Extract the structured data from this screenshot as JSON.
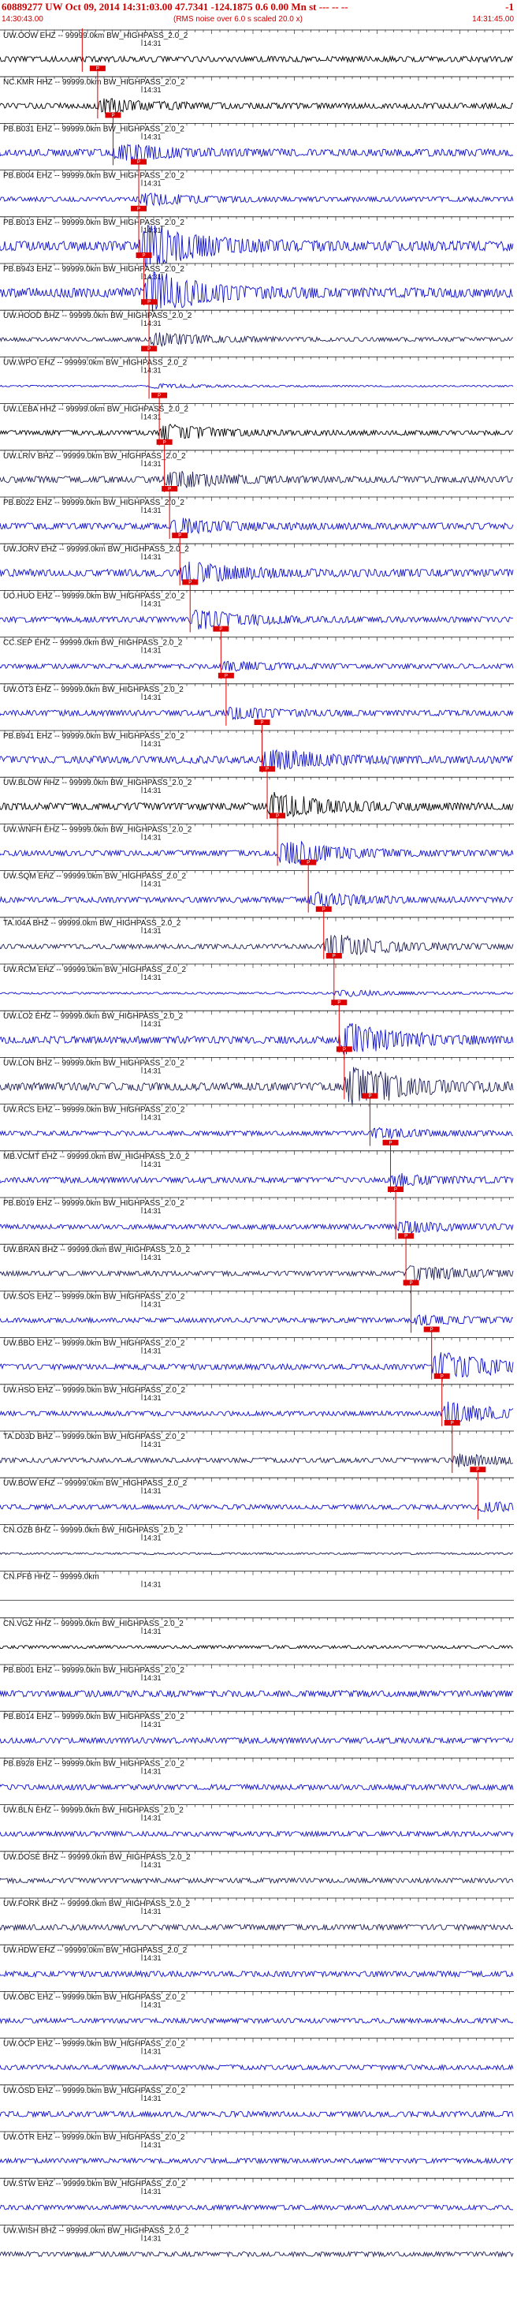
{
  "header": {
    "title": "60889277 UW Oct 09, 2014 14:31:03.00   47.7341 -124.1875  0.6 0.00 Mn st --- -- --",
    "right": "-1",
    "start_time": "14:30:43.00",
    "note": "(RMS noise over 6.0 s scaled 20.0 x)",
    "end_time": "14:31:45.00"
  },
  "colors": {
    "trace_blue": "#1010d0",
    "trace_black": "#000000",
    "trace_navy": "#20205a",
    "pick": "#dd0000",
    "axis": "#111111"
  },
  "chart_data": {
    "type": "line",
    "title": "60889277 UW Oct 09, 2014 14:31:03.00 47.7341 -124.1875 0.6 0.00 Mn",
    "x_range": [
      "14:30:43.00",
      "14:31:45.00"
    ],
    "time_marker": "14:31",
    "pick_label": "P",
    "traces": [
      {
        "label": "UW.OOW EHZ -- 99999.0km BW_HIGHPASS_2.0_2",
        "pick_t": 0.16,
        "amp": 0.35,
        "event": 0.0,
        "color": "black"
      },
      {
        "label": "NC.KMR HHZ -- 99999.0km BW_HIGHPASS_2.0_2",
        "pick_t": 0.19,
        "amp": 0.35,
        "event": 0.6,
        "color": "black"
      },
      {
        "label": "PB.B031 EHZ -- 99999.0km BW_HIGHPASS_2.0_2",
        "pick_t": 0.22,
        "amp": 0.45,
        "event": 0.7,
        "color": "blue"
      },
      {
        "label": "PB.B004 EHZ -- 99999.0km BW_HIGHPASS_2.0_2",
        "pick_t": 0.27,
        "amp": 0.3,
        "event": 0.5,
        "color": "blue"
      },
      {
        "label": "PB.B013 EHZ -- 99999.0km BW_HIGHPASS_2.0_2",
        "pick_t": 0.27,
        "amp": 0.6,
        "event": 2.2,
        "color": "blue"
      },
      {
        "label": "PB.B943 EHZ -- 99999.0km BW_HIGHPASS_2.0_2",
        "pick_t": 0.28,
        "amp": 0.6,
        "event": 2.0,
        "color": "blue"
      },
      {
        "label": "UW.HOOD BHZ -- 99999.0km BW_HIGHPASS_2.0_2",
        "pick_t": 0.29,
        "amp": 0.25,
        "event": 0.6,
        "color": "navy"
      },
      {
        "label": "UW.WPO EHZ -- 99999.0km BW_HIGHPASS_2.0_2",
        "pick_t": 0.29,
        "amp": 0.1,
        "event": 0.2,
        "color": "blue"
      },
      {
        "label": "UW.LEBA HHZ -- 99999.0km BW_HIGHPASS_2.0_2",
        "pick_t": 0.31,
        "amp": 0.3,
        "event": 0.8,
        "color": "black"
      },
      {
        "label": "UW.LRIV BHZ -- 99999.0km BW_HIGHPASS_2.0_2",
        "pick_t": 0.32,
        "amp": 0.4,
        "event": 0.8,
        "color": "navy"
      },
      {
        "label": "PB.B022 EHZ -- 99999.0km BW_HIGHPASS_2.0_2",
        "pick_t": 0.33,
        "amp": 0.4,
        "event": 0.6,
        "color": "blue"
      },
      {
        "label": "UW.JORV EHZ -- 99999.0km BW_HIGHPASS_2.0_2",
        "pick_t": 0.35,
        "amp": 0.45,
        "event": 1.0,
        "color": "blue"
      },
      {
        "label": "UO.HUO EHZ -- 99999.0km BW_HIGHPASS_2.0_2",
        "pick_t": 0.37,
        "amp": 0.35,
        "event": 0.9,
        "color": "blue"
      },
      {
        "label": "CC.SEP EHZ -- 99999.0km BW_HIGHPASS_2.0_2",
        "pick_t": 0.43,
        "amp": 0.3,
        "event": 0.4,
        "color": "blue"
      },
      {
        "label": "UW.OT3 EHZ -- 99999.0km BW_HIGHPASS_2.0_2",
        "pick_t": 0.44,
        "amp": 0.35,
        "event": 0.5,
        "color": "blue"
      },
      {
        "label": "PB.B941 EHZ -- 99999.0km BW_HIGHPASS_2.0_2",
        "pick_t": 0.51,
        "amp": 0.45,
        "event": 1.0,
        "color": "blue"
      },
      {
        "label": "UW.BLOW HHZ -- 99999.0km BW_HIGHPASS_2.0_2",
        "pick_t": 0.52,
        "amp": 0.45,
        "event": 1.2,
        "color": "black"
      },
      {
        "label": "UW.WNFH EHZ -- 99999.0km BW_HIGHPASS_2.0_2",
        "pick_t": 0.54,
        "amp": 0.35,
        "event": 1.3,
        "color": "blue"
      },
      {
        "label": "UW.SQM EHZ -- 99999.0km BW_HIGHPASS_2.0_2",
        "pick_t": 0.6,
        "amp": 0.35,
        "event": 0.6,
        "color": "blue"
      },
      {
        "label": "TA.I04A BHZ -- 99999.0km BW_HIGHPASS_2.0_2",
        "pick_t": 0.63,
        "amp": 0.3,
        "event": 1.2,
        "color": "navy"
      },
      {
        "label": "UW.RCM EHZ -- 99999.0km BW_HIGHPASS_2.0_2",
        "pick_t": 0.65,
        "amp": 0.12,
        "event": 0.3,
        "color": "blue"
      },
      {
        "label": "UW.LO2 EHZ -- 99999.0km BW_HIGHPASS_2.0_2",
        "pick_t": 0.66,
        "amp": 0.45,
        "event": 1.6,
        "color": "blue"
      },
      {
        "label": "UW.LON BHZ -- 99999.0km BW_HIGHPASS_2.0_2",
        "pick_t": 0.67,
        "amp": 0.5,
        "event": 2.0,
        "color": "navy"
      },
      {
        "label": "UW.RCS EHZ -- 99999.0km BW_HIGHPASS_2.0_2",
        "pick_t": 0.72,
        "amp": 0.3,
        "event": 0.4,
        "color": "blue"
      },
      {
        "label": "MB.VCMT EHZ -- 99999.0km BW_HIGHPASS_2.0_2",
        "pick_t": 0.76,
        "amp": 0.35,
        "event": 0.5,
        "color": "blue"
      },
      {
        "label": "PB.B019 EHZ -- 99999.0km BW_HIGHPASS_2.0_2",
        "pick_t": 0.77,
        "amp": 0.3,
        "event": 0.5,
        "color": "blue"
      },
      {
        "label": "UW.BRAN BHZ -- 99999.0km BW_HIGHPASS_2.0_2",
        "pick_t": 0.79,
        "amp": 0.3,
        "event": 0.7,
        "color": "navy"
      },
      {
        "label": "UW.SOS EHZ -- 99999.0km BW_HIGHPASS_2.0_2",
        "pick_t": 0.8,
        "amp": 0.3,
        "event": 0.4,
        "color": "blue"
      },
      {
        "label": "UW.BBO EHZ -- 99999.0km BW_HIGHPASS_2.0_2",
        "pick_t": 0.84,
        "amp": 0.35,
        "event": 1.5,
        "color": "blue"
      },
      {
        "label": "UW.HSO EHZ -- 99999.0km BW_HIGHPASS_2.0_2",
        "pick_t": 0.86,
        "amp": 0.3,
        "event": 1.0,
        "color": "blue"
      },
      {
        "label": "TA.D03D BHZ -- 99999.0km BW_HIGHPASS_2.0_2",
        "pick_t": 0.88,
        "amp": 0.3,
        "event": 0.5,
        "color": "navy"
      },
      {
        "label": "UW.BOW EHZ -- 99999.0km BW_HIGHPASS_2.0_2",
        "pick_t": 0.93,
        "amp": 0.3,
        "event": 0.4,
        "color": "blue"
      },
      {
        "label": "CN.OZB BHZ -- 99999.0km BW_HIGHPASS_2.0_2",
        "pick_t": null,
        "amp": 0.12,
        "event": 0.0,
        "color": "navy"
      },
      {
        "label": "CN.PFB HHZ -- 99999.0km",
        "pick_t": null,
        "amp": 0.0,
        "event": 0.0,
        "color": "black"
      },
      {
        "label": "CN.VGZ HHZ -- 99999.0km BW_HIGHPASS_2.0_2",
        "pick_t": null,
        "amp": 0.2,
        "event": 0.0,
        "color": "black"
      },
      {
        "label": "PB.B001 EHZ -- 99999.0km BW_HIGHPASS_2.0_2",
        "pick_t": null,
        "amp": 0.4,
        "event": 0.0,
        "color": "blue"
      },
      {
        "label": "PB.B014 EHZ -- 99999.0km BW_HIGHPASS_2.0_2",
        "pick_t": null,
        "amp": 0.35,
        "event": 0.0,
        "color": "blue"
      },
      {
        "label": "PB.B928 EHZ -- 99999.0km BW_HIGHPASS_2.0_2",
        "pick_t": null,
        "amp": 0.35,
        "event": 0.0,
        "color": "blue"
      },
      {
        "label": "UW.BLN EHZ -- 99999.0km BW_HIGHPASS_2.0_2",
        "pick_t": null,
        "amp": 0.3,
        "event": 0.0,
        "color": "blue"
      },
      {
        "label": "UW.DOSE BHZ -- 99999.0km BW_HIGHPASS_2.0_2",
        "pick_t": null,
        "amp": 0.3,
        "event": 0.0,
        "color": "navy"
      },
      {
        "label": "UW.FORK BHZ -- 99999.0km BW_HIGHPASS_2.0_2",
        "pick_t": null,
        "amp": 0.35,
        "event": 0.0,
        "color": "navy"
      },
      {
        "label": "UW.HDW EHZ -- 99999.0km BW_HIGHPASS_2.0_2",
        "pick_t": null,
        "amp": 0.35,
        "event": 0.0,
        "color": "blue"
      },
      {
        "label": "UW.OBC EHZ -- 99999.0km BW_HIGHPASS_2.0_2",
        "pick_t": null,
        "amp": 0.3,
        "event": 0.0,
        "color": "blue"
      },
      {
        "label": "UW.OCP EHZ -- 99999.0km BW_HIGHPASS_2.0_2",
        "pick_t": null,
        "amp": 0.3,
        "event": 0.0,
        "color": "blue"
      },
      {
        "label": "UW.OSD EHZ -- 99999.0km BW_HIGHPASS_2.0_2",
        "pick_t": null,
        "amp": 0.35,
        "event": 0.0,
        "color": "blue"
      },
      {
        "label": "UW.OTR EHZ -- 99999.0km BW_HIGHPASS_2.0_2",
        "pick_t": null,
        "amp": 0.3,
        "event": 0.0,
        "color": "blue"
      },
      {
        "label": "UW.STW EHZ -- 99999.0km BW_HIGHPASS_2.0_2",
        "pick_t": null,
        "amp": 0.3,
        "event": 0.0,
        "color": "blue"
      },
      {
        "label": "UW.WISH BHZ -- 99999.0km BW_HIGHPASS_2.0_2",
        "pick_t": null,
        "amp": 0.3,
        "event": 0.0,
        "color": "navy"
      }
    ]
  }
}
